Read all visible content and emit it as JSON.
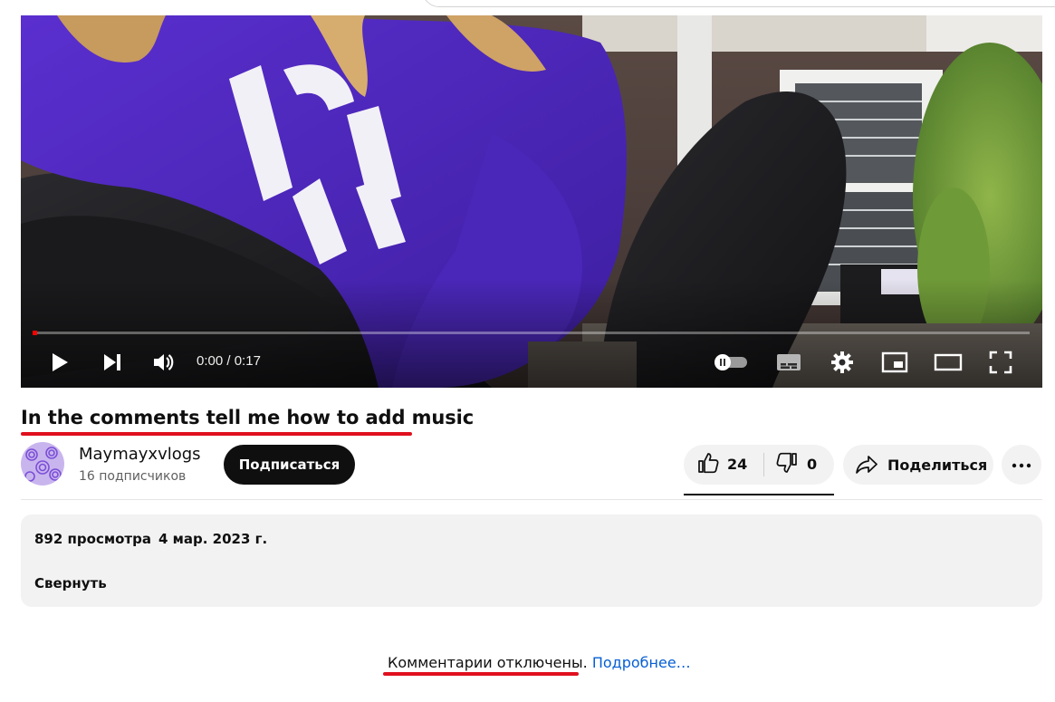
{
  "player": {
    "time_current": "0:00",
    "time_separator": " / ",
    "time_total": "0:17",
    "progress_fraction": 0.0,
    "accent_color": "#ff0000",
    "controls": [
      "play-icon",
      "next-icon",
      "volume-icon",
      "autoplay-toggle-icon",
      "subtitles-icon",
      "settings-icon",
      "miniplayer-icon",
      "theater-icon",
      "fullscreen-icon"
    ]
  },
  "video": {
    "title": "In the comments tell me how to add music"
  },
  "channel": {
    "name": "Maymayxvlogs",
    "subscribers": "16 подписчиков",
    "subscribe_label": "Подписаться"
  },
  "actions": {
    "likes": "24",
    "dislikes": "0",
    "share_label": "Поделиться"
  },
  "description": {
    "views": "892 просмотра",
    "date": "4 мар. 2023 г.",
    "collapse_label": "Свернуть"
  },
  "comments": {
    "disabled_text": "Комментарии отключены",
    "period": ".",
    "learn_more": "Подробнее…"
  },
  "colors": {
    "annotation_underline": "#e0101e",
    "link": "#065fd4",
    "subscribe_bg": "#0f0f0f",
    "chip_bg": "#f2f2f2"
  }
}
